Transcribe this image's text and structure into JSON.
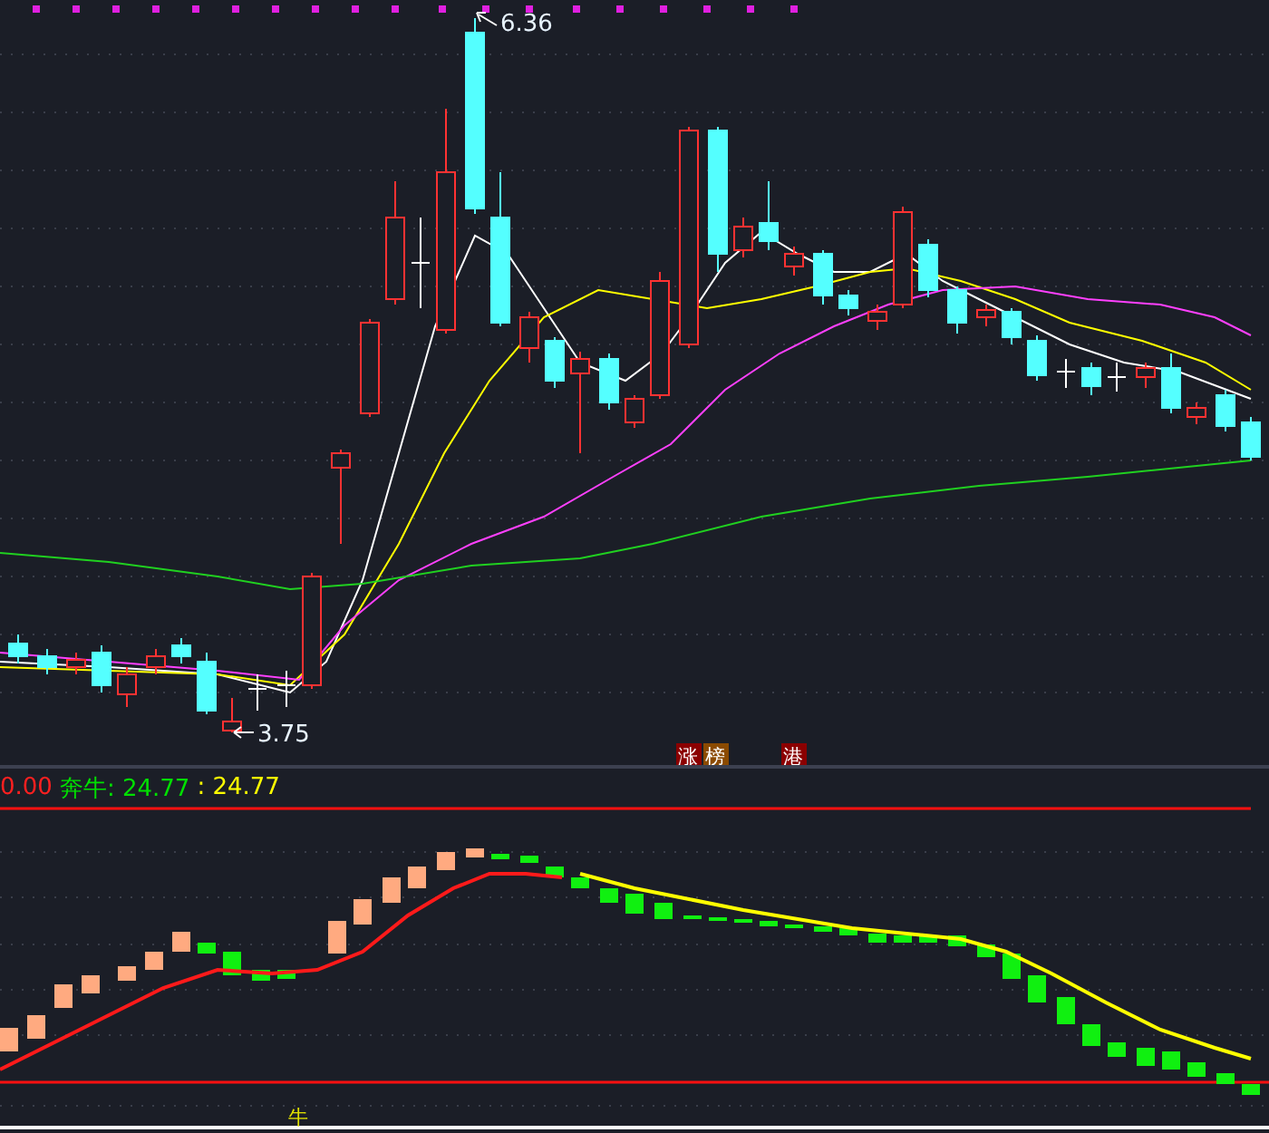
{
  "price_chart": {
    "high_label": "6.36",
    "low_label": "3.75",
    "tags": [
      {
        "text": "涨",
        "color": "#8b0000"
      },
      {
        "text": "榜",
        "color": "#8b4a00"
      },
      {
        "text": "港",
        "color": "#8b0000"
      }
    ]
  },
  "indicator": {
    "values": [
      {
        "text": "0.00",
        "color": "#ff2020"
      },
      {
        "text": "奔牛: 24.77",
        "color": "#00e000"
      },
      {
        "text": ": 24.77",
        "color": "#ffff00"
      }
    ],
    "marker": "牛"
  }
}
